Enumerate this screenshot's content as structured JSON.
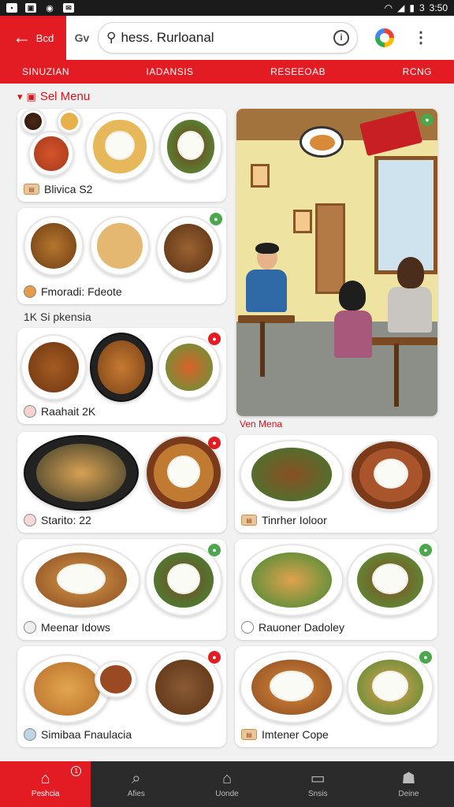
{
  "status_bar": {
    "time": "3:50",
    "extra": "3"
  },
  "header": {
    "back_label": "Bcd",
    "tabs_label": "Gv",
    "search_value": "hess. Rurloanal",
    "info_label": "i"
  },
  "categories": [
    "SINUZIAN",
    "IADANSIS",
    "RESEEOAB",
    "RCNG"
  ],
  "section_title": "Sel Menu",
  "subhead": "1K Si pkensia",
  "scene_caption": "Ven Mena",
  "cards": [
    {
      "label": "Blivica S2"
    },
    {
      "label": "Fmoradi: Fdeote"
    },
    {
      "label": "Raahait 2K"
    },
    {
      "label": "Starito: 22"
    },
    {
      "label": "Tinrher Ioloor"
    },
    {
      "label": "Meenar Idows"
    },
    {
      "label": "Rauoner Dadoley"
    },
    {
      "label": "Simibaa Fnaulacia"
    },
    {
      "label": "Imtener Cope"
    }
  ],
  "bottom_nav": [
    {
      "label": "Peshcia",
      "icon": "home-icon",
      "active": true,
      "badge": "1"
    },
    {
      "label": "Afies",
      "icon": "search-doc-icon"
    },
    {
      "label": "Uonde",
      "icon": "home-outline-icon"
    },
    {
      "label": "Snsis",
      "icon": "book-icon"
    },
    {
      "label": "Deine",
      "icon": "profile-icon"
    }
  ],
  "colors": {
    "brand_red": "#e31b23",
    "badge_green": "#4aa84a",
    "nav_dark": "#2b2b2b"
  }
}
